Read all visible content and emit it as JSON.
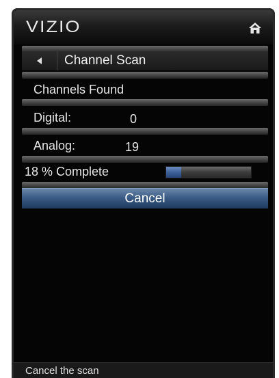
{
  "header": {
    "brand": "VIZIO",
    "home_icon": "home-icon"
  },
  "menu": {
    "title": "Channel Scan",
    "back_icon": "back-arrow-icon",
    "channels_found_label": "Channels Found",
    "digital_label": "Digital:",
    "digital_value": "0",
    "analog_label": "Analog:",
    "analog_value": "19",
    "progress_label": "18 % Complete",
    "progress_fraction": 0.18,
    "cancel_label": "Cancel"
  },
  "status": {
    "help_text": "Cancel the scan"
  },
  "colors": {
    "accent": "#3b5c86",
    "progress_fill": "#3a5e98",
    "background": "#050505"
  }
}
